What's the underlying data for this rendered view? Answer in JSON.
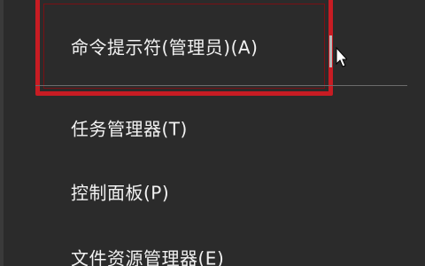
{
  "context_menu": {
    "items": [
      {
        "label": "命令提示符(管理员)(A)"
      },
      {
        "label": "任务管理器(T)"
      },
      {
        "label": "控制面板(P)"
      },
      {
        "label": "文件资源管理器(E)"
      }
    ]
  },
  "colors": {
    "menu_background": "#2b2b2b",
    "text": "#f2f2f2",
    "highlight_border": "#c81c23",
    "separator": "#6c6c6c"
  },
  "icons": {
    "cursor": "mouse-pointer-arrow-icon"
  }
}
